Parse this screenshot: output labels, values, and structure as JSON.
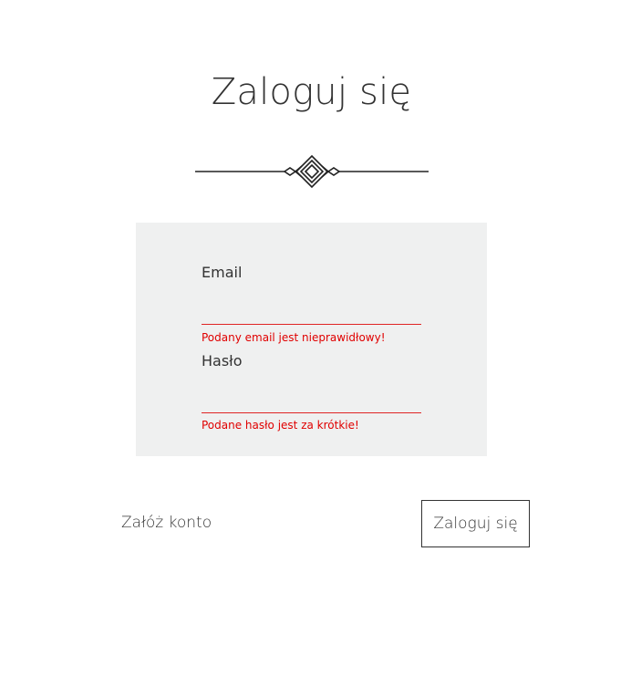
{
  "page": {
    "title": "Zaloguj się"
  },
  "form": {
    "email": {
      "label": "Email",
      "value": "",
      "error": "Podany email jest nieprawidłowy!"
    },
    "password": {
      "label": "Hasło",
      "value": "",
      "error": "Podane hasło jest za krótkie!"
    }
  },
  "actions": {
    "register_label": "Załóż konto",
    "login_label": "Zaloguj się"
  },
  "colors": {
    "error": "#e00000",
    "panel_background": "#eff0f0",
    "text": "#333333"
  },
  "icons": {
    "divider": "ornamental-diamond-divider-icon"
  }
}
